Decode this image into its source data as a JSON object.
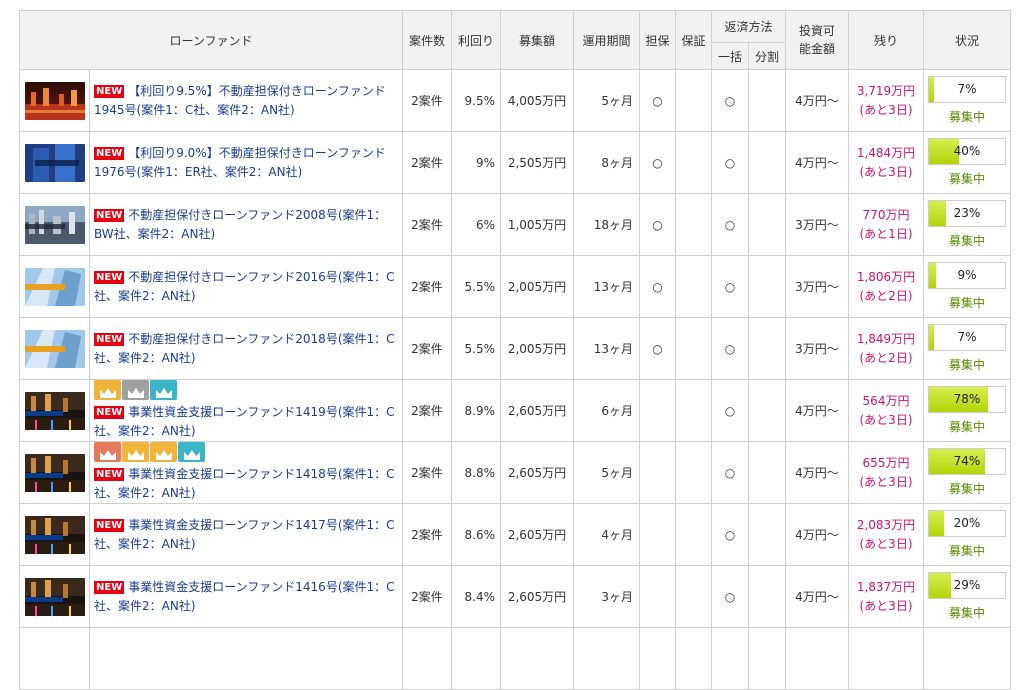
{
  "header": {
    "fund": "ローンファンド",
    "count": "案件数",
    "yield": "利回り",
    "amount": "募集額",
    "period": "運用期間",
    "collateral": "担保",
    "guarantee": "保証",
    "repay": "返済方法",
    "lump": "一括",
    "split": "分割",
    "min": "投資可能金額",
    "remain": "残り",
    "status": "状況"
  },
  "badge_new": "NEW",
  "colors": {
    "new_badge": "#e60012",
    "title_link": "#1a3c8c",
    "remaining": "#d1126b",
    "status_text": "#5a8a00",
    "bar_fill": "#c6e22a"
  },
  "rows": [
    {
      "thumb": "city-night-red",
      "crowns": [],
      "title": "【利回り9.5%】不動産担保付きローンファンド1945号(案件1：C社、案件2：AN社)",
      "count": "2案件",
      "yield": "9.5%",
      "amount": "4,005万円",
      "period": "5ヶ月",
      "collateral": "○",
      "guarantee": "",
      "lump": "○",
      "split": "",
      "min": "4万円〜",
      "remain": "3,719万円",
      "days": "(あと3日)",
      "pct": 7,
      "pct_label": "7%",
      "status": "募集中"
    },
    {
      "thumb": "building-blue",
      "crowns": [],
      "title": "【利回り9.0%】不動産担保付きローンファンド1976号(案件1：ER社、案件2：AN社)",
      "count": "2案件",
      "yield": "9%",
      "amount": "2,505万円",
      "period": "8ヶ月",
      "collateral": "○",
      "guarantee": "",
      "lump": "○",
      "split": "",
      "min": "4万円〜",
      "remain": "1,484万円",
      "days": "(あと3日)",
      "pct": 40,
      "pct_label": "40%",
      "status": "募集中"
    },
    {
      "thumb": "city-aerial",
      "crowns": [],
      "title": "不動産担保付きローンファンド2008号(案件1：BW社、案件2：AN社)",
      "count": "2案件",
      "yield": "6%",
      "amount": "1,005万円",
      "period": "18ヶ月",
      "collateral": "○",
      "guarantee": "",
      "lump": "○",
      "split": "",
      "min": "3万円〜",
      "remain": "770万円",
      "days": "(あと1日)",
      "pct": 23,
      "pct_label": "23%",
      "status": "募集中"
    },
    {
      "thumb": "building-sky",
      "crowns": [],
      "title": "不動産担保付きローンファンド2016号(案件1：C社、案件2：AN社)",
      "count": "2案件",
      "yield": "5.5%",
      "amount": "2,005万円",
      "period": "13ヶ月",
      "collateral": "○",
      "guarantee": "",
      "lump": "○",
      "split": "",
      "min": "3万円〜",
      "remain": "1,806万円",
      "days": "(あと2日)",
      "pct": 9,
      "pct_label": "9%",
      "status": "募集中"
    },
    {
      "thumb": "building-sky",
      "crowns": [],
      "title": "不動産担保付きローンファンド2018号(案件1：C社、案件2：AN社)",
      "count": "2案件",
      "yield": "5.5%",
      "amount": "2,005万円",
      "period": "13ヶ月",
      "collateral": "○",
      "guarantee": "",
      "lump": "○",
      "split": "",
      "min": "3万円〜",
      "remain": "1,849万円",
      "days": "(あと2日)",
      "pct": 7,
      "pct_label": "7%",
      "status": "募集中"
    },
    {
      "thumb": "harbor-night",
      "crowns": [
        "#f0b43c",
        "#a0a0a0",
        "#3cb4c8"
      ],
      "title": "事業性資金支援ローンファンド1419号(案件1：C社、案件2：AN社)",
      "count": "2案件",
      "yield": "8.9%",
      "amount": "2,605万円",
      "period": "6ヶ月",
      "collateral": "",
      "guarantee": "",
      "lump": "○",
      "split": "",
      "min": "4万円〜",
      "remain": "564万円",
      "days": "(あと3日)",
      "pct": 78,
      "pct_label": "78%",
      "status": "募集中"
    },
    {
      "thumb": "harbor-night",
      "crowns": [
        "#e8785a",
        "#f0b43c",
        "#f0b43c",
        "#3cb4c8"
      ],
      "title": "事業性資金支援ローンファンド1418号(案件1：C社、案件2：AN社)",
      "count": "2案件",
      "yield": "8.8%",
      "amount": "2,605万円",
      "period": "5ヶ月",
      "collateral": "",
      "guarantee": "",
      "lump": "○",
      "split": "",
      "min": "4万円〜",
      "remain": "655万円",
      "days": "(あと3日)",
      "pct": 74,
      "pct_label": "74%",
      "status": "募集中"
    },
    {
      "thumb": "harbor-night",
      "crowns": [],
      "title": "事業性資金支援ローンファンド1417号(案件1：C社、案件2：AN社)",
      "count": "2案件",
      "yield": "8.6%",
      "amount": "2,605万円",
      "period": "4ヶ月",
      "collateral": "",
      "guarantee": "",
      "lump": "○",
      "split": "",
      "min": "4万円〜",
      "remain": "2,083万円",
      "days": "(あと3日)",
      "pct": 20,
      "pct_label": "20%",
      "status": "募集中"
    },
    {
      "thumb": "harbor-night",
      "crowns": [],
      "title": "事業性資金支援ローンファンド1416号(案件1：C社、案件2：AN社)",
      "count": "2案件",
      "yield": "8.4%",
      "amount": "2,605万円",
      "period": "3ヶ月",
      "collateral": "",
      "guarantee": "",
      "lump": "○",
      "split": "",
      "min": "4万円〜",
      "remain": "1,837万円",
      "days": "(あと3日)",
      "pct": 29,
      "pct_label": "29%",
      "status": "募集中"
    }
  ]
}
